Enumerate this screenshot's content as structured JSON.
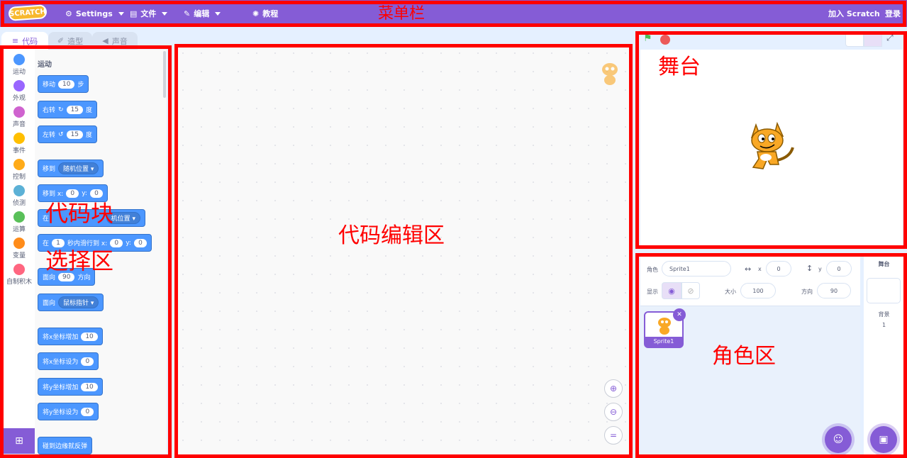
{
  "menu": {
    "logo": "SCRATCH",
    "settings": "Settings",
    "file": "文件",
    "edit": "编辑",
    "tutorial": "教程",
    "join": "加入 Scratch",
    "login": "登录"
  },
  "tabs": {
    "code": "代码",
    "costume": "造型",
    "sound": "声音"
  },
  "categories": [
    "运动",
    "外观",
    "声音",
    "事件",
    "控制",
    "侦测",
    "运算",
    "变量",
    "自制积木"
  ],
  "category_colors": [
    "#4c97ff",
    "#9966ff",
    "#cf63cf",
    "#ffbf00",
    "#ffab19",
    "#5cb1d6",
    "#59c059",
    "#ff8c1a",
    "#ff6680"
  ],
  "palette": {
    "title": "运动",
    "move": {
      "label": "移动",
      "value": "10",
      "unit": "步"
    },
    "turn_right": {
      "label": "右转",
      "value": "15",
      "unit": "度"
    },
    "turn_left": {
      "label": "左转",
      "value": "15",
      "unit": "度"
    },
    "goto": {
      "label": "移到",
      "option": "随机位置"
    },
    "goto_xy": {
      "label": "移到 x:",
      "x": "0",
      "ylabel": "y:",
      "y": "0"
    },
    "glide": {
      "prefix": "在",
      "option": "机位置"
    },
    "glide_xy": {
      "prefix": "在",
      "secs": "1",
      "mid": "秒内滑行到 x:",
      "x": "0",
      "ylabel": "y:",
      "y": "0"
    },
    "point_dir": {
      "label": "面向",
      "value": "90",
      "unit": "方向"
    },
    "point_towards": {
      "label": "面向",
      "option": "鼠标指针"
    },
    "change_x": {
      "label": "将x坐标增加",
      "value": "10"
    },
    "set_x": {
      "label": "将x坐标设为",
      "value": "0"
    },
    "change_y": {
      "label": "将y坐标增加",
      "value": "10"
    },
    "set_y": {
      "label": "将y坐标设为",
      "value": "0"
    },
    "bounce": {
      "label": "碰到边缘就反弹"
    }
  },
  "sprite_info": {
    "sprite_label": "角色",
    "sprite_name": "Sprite1",
    "x_label": "x",
    "x": "0",
    "y_label": "y",
    "y": "0",
    "show_label": "显示",
    "size_label": "大小",
    "size": "100",
    "direction_label": "方向",
    "direction": "90"
  },
  "sprite_tile": {
    "name": "Sprite1"
  },
  "stage_pane": {
    "title": "舞台",
    "backdrop_label": "背景",
    "backdrop_count": "1"
  },
  "annotations": {
    "menu": "菜单栏",
    "stage": "舞台",
    "blocks_line1": "代码块",
    "blocks_line2": "选择区",
    "editor": "代码编辑区",
    "sprites": "角色区"
  }
}
